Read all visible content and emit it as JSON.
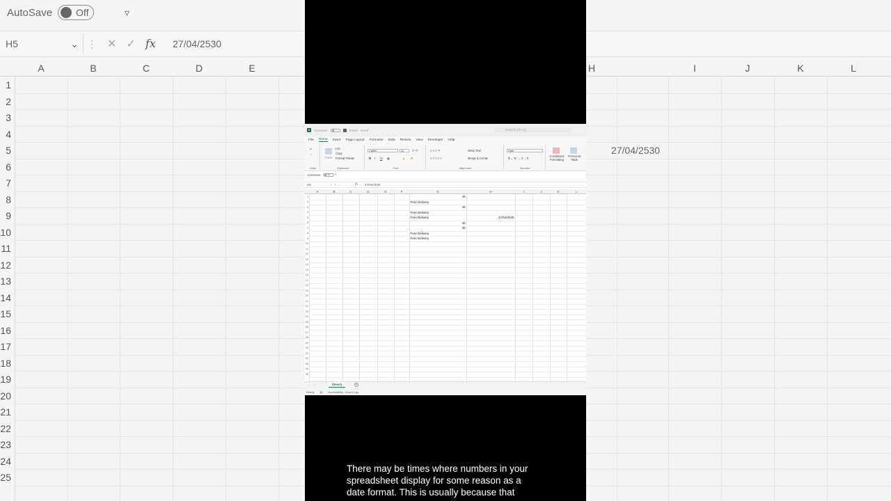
{
  "background": {
    "autosave_label": "AutoSave",
    "autosave_state": "Off",
    "name_box": "H5",
    "formula_value": "27/04/2530",
    "columns_left": [
      "A",
      "B",
      "C",
      "D",
      "E"
    ],
    "columns_right": [
      "H",
      "I",
      "J",
      "K",
      "L"
    ],
    "rows": [
      "1",
      "2",
      "3",
      "4",
      "5",
      "6",
      "7",
      "8",
      "9",
      "10",
      "11",
      "12",
      "13",
      "14",
      "15",
      "16",
      "17",
      "18",
      "19",
      "20",
      "21",
      "22",
      "23",
      "24",
      "25"
    ],
    "cell_h5": "27/04/2530"
  },
  "excel": {
    "titlebar": {
      "autosave": "AutoSave",
      "filename": "Book1",
      "app": "Excel",
      "search_placeholder": "Search (Alt+Q)"
    },
    "menu": [
      "File",
      "Home",
      "Insert",
      "Page Layout",
      "Formulas",
      "Data",
      "Review",
      "View",
      "Developer",
      "Help"
    ],
    "ribbon": {
      "undo_label": "Undo",
      "paste_label": "Paste",
      "cut": "Cut",
      "copy": "Copy",
      "format_painter": "Format Painter",
      "clipboard_label": "Clipboard",
      "font_name": "Calibri",
      "font_size": "11",
      "font_label": "Font",
      "wrap_text": "Wrap Text",
      "merge_center": "Merge & Center",
      "alignment_label": "Alignment",
      "number_format": "Date",
      "number_label": "Number",
      "conditional_formatting": "Conditional Formatting",
      "format_as_table": "Format as Table"
    },
    "quickbar": {
      "autosave": "AutoSave",
      "state": "Off"
    },
    "formula_bar": {
      "name_box": "H5",
      "fx": "fx",
      "value": "27/04/2530"
    },
    "columns": [
      "A",
      "B",
      "C",
      "D",
      "E",
      "F",
      "G",
      "H",
      "I",
      "J",
      "K",
      "L"
    ],
    "rows": [
      "1",
      "2",
      "3",
      "4",
      "5",
      "6",
      "7",
      "8",
      "9",
      "10",
      "11",
      "12",
      "13",
      "14",
      "15",
      "16",
      "17",
      "18",
      "19",
      "20",
      "21",
      "22",
      "23",
      "24",
      "25",
      "26",
      "27",
      "28",
      "29",
      "30",
      "31",
      "32",
      "33",
      "34",
      "35"
    ],
    "cells": {
      "G1": "40",
      "G2": "Free Delivery",
      "G3": "40",
      "G4": "Free Delivery",
      "G5": "Free Delivery",
      "H5": "27/04/2530",
      "G6": "40",
      "G7": "40",
      "G8": "Free Delivery",
      "G9": "Free Delivery"
    },
    "sheet_tab": "Sheet1",
    "status": {
      "ready": "Ready",
      "accessibility": "Accessibility: Good to go"
    }
  },
  "caption": "There may be times where numbers in your\nspreadsheet display for some reason as a\ndate format.  This is usually because that"
}
